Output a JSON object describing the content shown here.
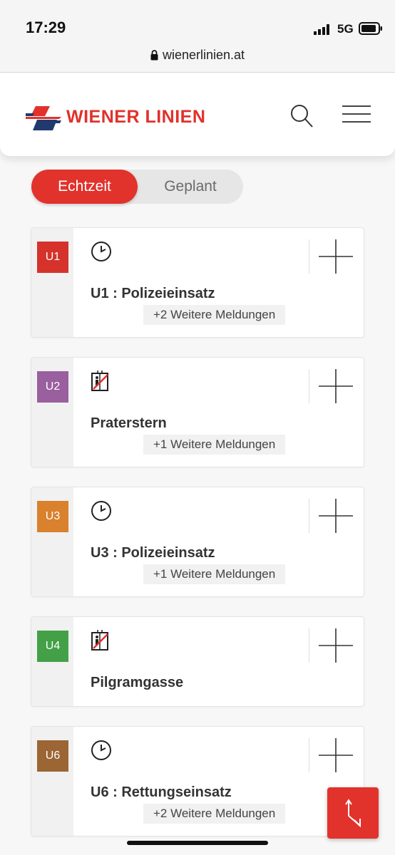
{
  "status_bar": {
    "time": "17:29",
    "network": "5G",
    "url": "wienerlinien.at"
  },
  "header": {
    "brand": "WIENER LINIEN",
    "brand_color": "#e0312b"
  },
  "toggle": {
    "active_label": "Echtzeit",
    "inactive_label": "Geplant",
    "active_color": "#e2322c"
  },
  "disruptions": [
    {
      "line": "U1",
      "line_color": "#d5322c",
      "icon": "clock-icon",
      "title": "U1 : Polizeieinsatz",
      "more": "+2 Weitere Meldungen"
    },
    {
      "line": "U2",
      "line_color": "#9a5f9f",
      "icon": "elevator-out-of-service-icon",
      "title": "Praterstern",
      "more": "+1 Weitere Meldungen"
    },
    {
      "line": "U3",
      "line_color": "#d9812d",
      "icon": "clock-icon",
      "title": "U3 : Polizeieinsatz",
      "more": "+1 Weitere Meldungen"
    },
    {
      "line": "U4",
      "line_color": "#43a047",
      "icon": "elevator-out-of-service-icon",
      "title": "Pilgramgasse",
      "more": ""
    },
    {
      "line": "U6",
      "line_color": "#9b6534",
      "icon": "clock-icon",
      "title": "U6 : Rettungseinsatz",
      "more": "+2 Weitere Meldungen"
    }
  ]
}
